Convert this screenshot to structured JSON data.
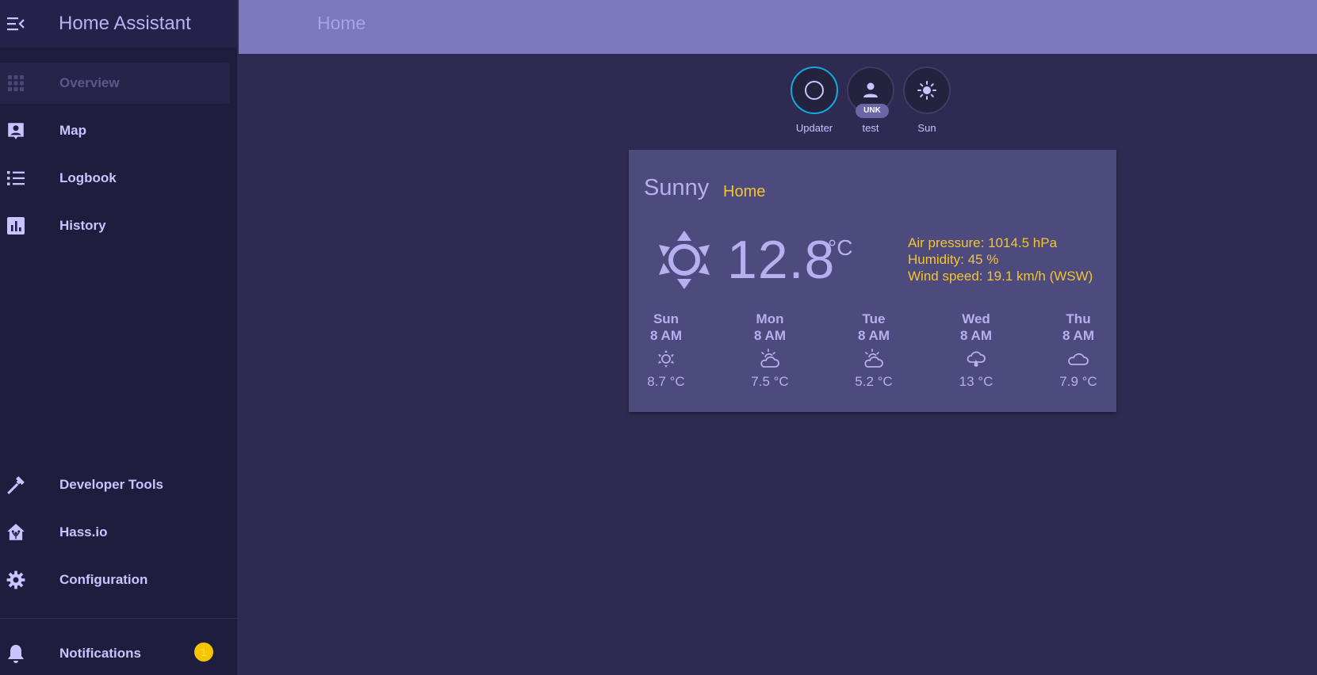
{
  "app": {
    "title": "Home Assistant"
  },
  "header": {
    "title": "Home"
  },
  "colors": {
    "accent": "#f4c430",
    "sidebar_bg": "#1f1d3d",
    "header_bg": "#7b78bd",
    "card_bg": "#4d4a7e",
    "page_bg": "#2e2a52"
  },
  "sidebar": {
    "items": [
      {
        "label": "Overview",
        "icon": "view-dashboard-icon",
        "selected": true
      },
      {
        "label": "Map",
        "icon": "account-box-icon"
      },
      {
        "label": "Logbook",
        "icon": "format-list-bulleted-icon"
      },
      {
        "label": "History",
        "icon": "chart-box-icon"
      }
    ],
    "bottom_items": [
      {
        "label": "Developer Tools",
        "icon": "hammer-icon"
      },
      {
        "label": "Hass.io",
        "icon": "home-assistant-icon"
      },
      {
        "label": "Configuration",
        "icon": "cog-icon"
      }
    ],
    "notifications": {
      "label": "Notifications",
      "count": "1"
    }
  },
  "badges": [
    {
      "label": "Updater",
      "icon": "circle-outline-icon"
    },
    {
      "label": "test",
      "icon": "person-icon",
      "state": "UNK"
    },
    {
      "label": "Sun",
      "icon": "sun-icon"
    }
  ],
  "weather": {
    "state": "Sunny",
    "name": "Home",
    "temperature": "12.8",
    "unit": "°C",
    "attributes": [
      "Air pressure: 1014.5 hPa",
      "Humidity: 45 %",
      "Wind speed: 19.1 km/h (WSW)"
    ],
    "forecast": [
      {
        "day": "Sun",
        "time": "8 AM",
        "icon": "sunny-icon",
        "temp": "8.7 °C"
      },
      {
        "day": "Mon",
        "time": "8 AM",
        "icon": "partly-cloudy-icon",
        "temp": "7.5 °C"
      },
      {
        "day": "Tue",
        "time": "8 AM",
        "icon": "partly-cloudy-icon",
        "temp": "5.2 °C"
      },
      {
        "day": "Wed",
        "time": "8 AM",
        "icon": "rainy-icon",
        "temp": "13 °C"
      },
      {
        "day": "Thu",
        "time": "8 AM",
        "icon": "cloudy-icon",
        "temp": "7.9 °C"
      }
    ]
  }
}
